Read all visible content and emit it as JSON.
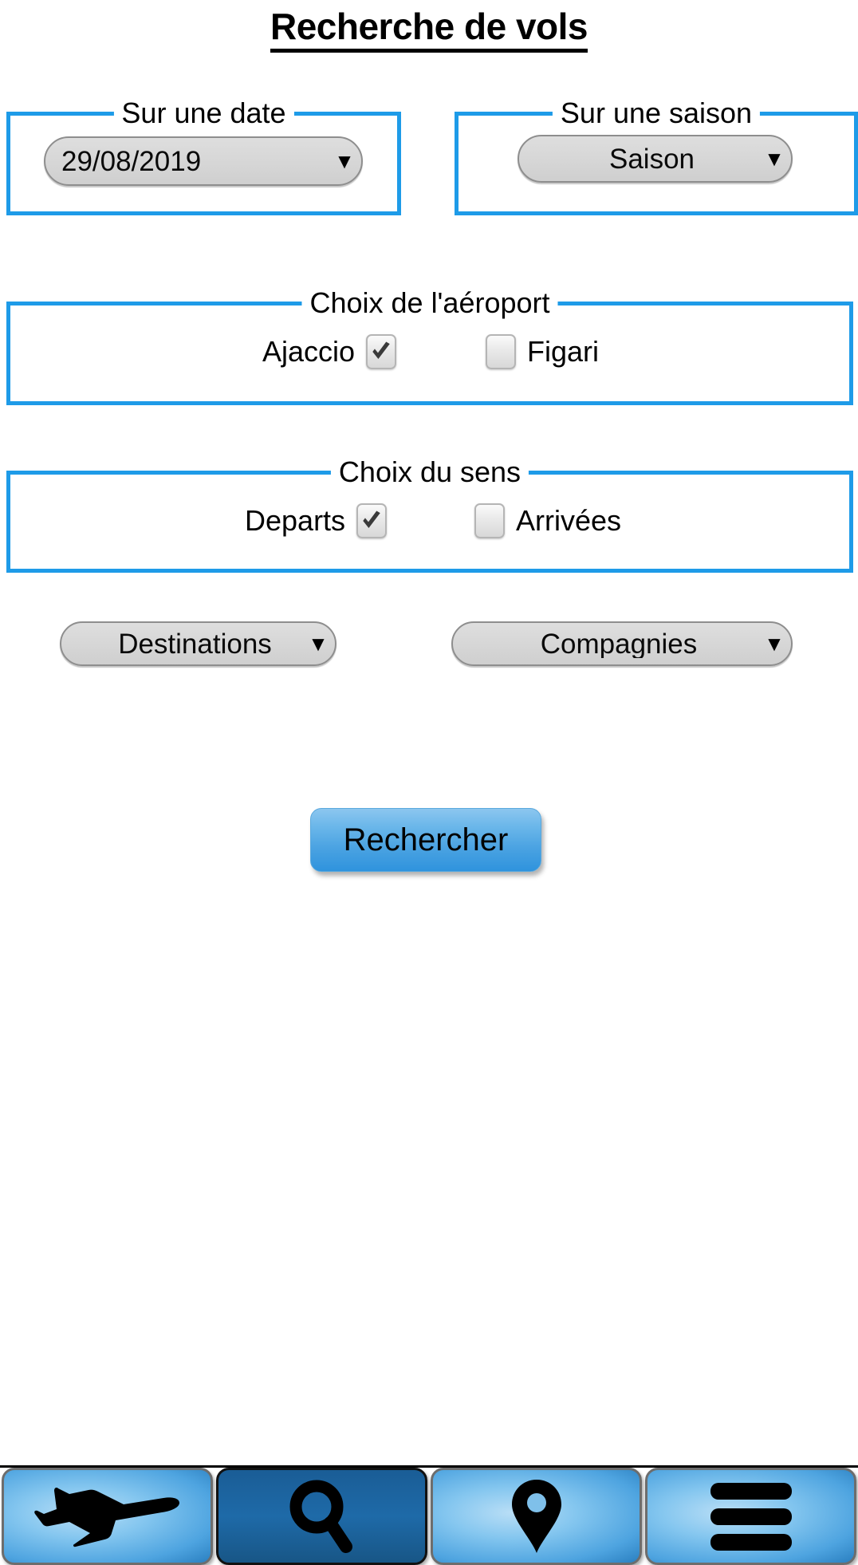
{
  "header": {
    "title": "Recherche de vols"
  },
  "groups": {
    "date": {
      "legend": "Sur une date",
      "spinner_value": "29/08/2019",
      "spinner_arrow": "▼"
    },
    "season": {
      "legend": "Sur une saison",
      "spinner_value": "Saison",
      "spinner_arrow": "▼"
    },
    "airport": {
      "legend": "Choix de l'aéroport",
      "options": [
        {
          "label": "Ajaccio",
          "checked": true,
          "label_side": "left"
        },
        {
          "label": "Figari",
          "checked": false,
          "label_side": "right"
        }
      ]
    },
    "direction": {
      "legend": "Choix du sens",
      "options": [
        {
          "label": "Departs",
          "checked": true,
          "label_side": "left"
        },
        {
          "label": "Arrivées",
          "checked": false,
          "label_side": "right"
        }
      ]
    }
  },
  "filters": {
    "destinations": {
      "value": "Destinations",
      "arrow": "▼"
    },
    "companies": {
      "value": "Compagnies",
      "arrow": "▼"
    }
  },
  "actions": {
    "search_label": "Rechercher"
  },
  "bottom_nav": {
    "items": [
      {
        "icon": "airplane-icon",
        "active": false
      },
      {
        "icon": "search-icon",
        "active": true
      },
      {
        "icon": "location-pin-icon",
        "active": false
      },
      {
        "icon": "hamburger-menu-icon",
        "active": false
      }
    ]
  },
  "colors": {
    "group_border": "#1e9be8",
    "nav_active": "#1a5d96",
    "button_blue": "#4ba3e2"
  }
}
